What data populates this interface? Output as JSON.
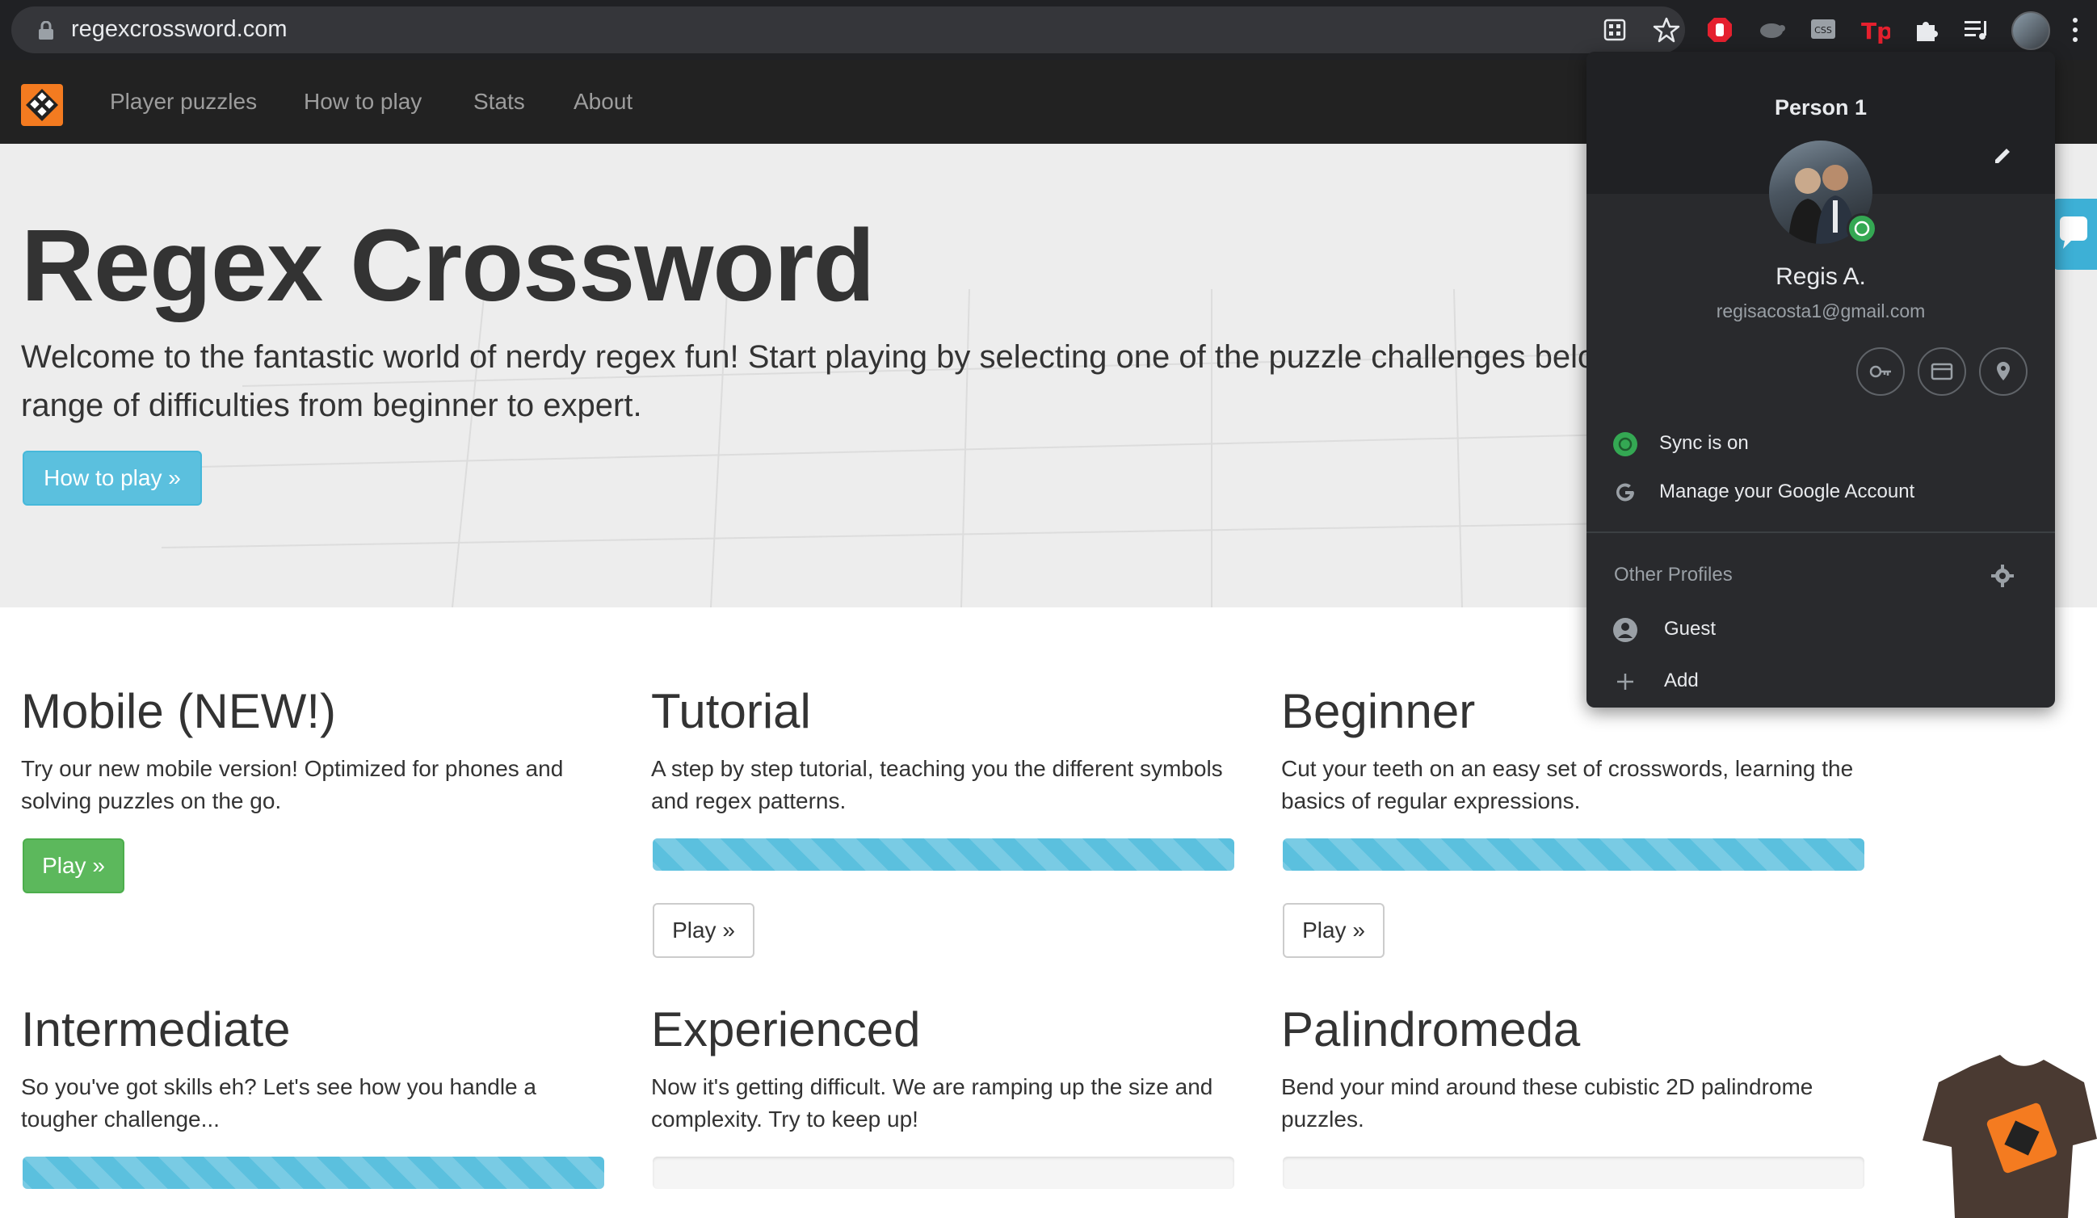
{
  "browser": {
    "url": "regexcrossword.com"
  },
  "nav": {
    "links": [
      "Player puzzles",
      "How to play",
      "Stats",
      "About"
    ]
  },
  "hero": {
    "title": "Regex Crossword",
    "lead": "Welcome to the fantastic world of nerdy regex fun! Start playing by selecting one of the puzzle challenges below",
    "lead2": "range of difficulties from beginner to expert.",
    "button": "How to play »"
  },
  "cards": [
    {
      "title": "Mobile (NEW!)",
      "text": "Try our new mobile version! Optimized for phones and solving puzzles on the go.",
      "button": "Play »",
      "progress": null
    },
    {
      "title": "Tutorial",
      "text": "A step by step tutorial, teaching you the different symbols and regex patterns.",
      "button": "Play »",
      "progress": 100
    },
    {
      "title": "Beginner",
      "text": "Cut your teeth on an easy set of crosswords, learning the basics of regular expressions.",
      "button": "Play »",
      "progress": 100
    },
    {
      "title": "Intermediate",
      "text": "So you've got skills eh? Let's see how you handle a tougher challenge...",
      "button": "",
      "progress": 100
    },
    {
      "title": "Experienced",
      "text": "Now it's getting difficult. We are ramping up the size and complexity. Try to keep up!",
      "button": "",
      "progress": 0
    },
    {
      "title": "Palindromeda",
      "text": "Bend your mind around these cubistic 2D palindrome puzzles.",
      "button": "",
      "progress": 0
    }
  ],
  "profile": {
    "header": "Person 1",
    "name": "Regis A.",
    "email": "regisacosta1@gmail.com",
    "sync": "Sync is on",
    "manage": "Manage your Google Account",
    "other_profiles": "Other Profiles",
    "guest": "Guest",
    "add": "Add"
  },
  "colors": {
    "accent": "#5bc0de",
    "success": "#5cb85c",
    "brand": "#f47b20",
    "sync_green": "#34a853"
  }
}
